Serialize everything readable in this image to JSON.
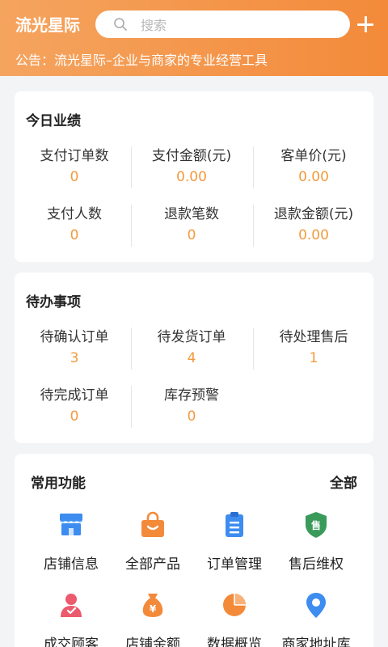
{
  "header": {
    "title": "流光星际",
    "search_placeholder": "搜索",
    "notice": "公告：流光星际–企业与商家的专业经营工具"
  },
  "today": {
    "title": "今日业绩",
    "items": [
      {
        "label": "支付订单数",
        "value": "0"
      },
      {
        "label": "支付金额(元)",
        "value": "0.00"
      },
      {
        "label": "客单价(元)",
        "value": "0.00"
      },
      {
        "label": "支付人数",
        "value": "0"
      },
      {
        "label": "退款笔数",
        "value": "0"
      },
      {
        "label": "退款金额(元)",
        "value": "0.00"
      }
    ]
  },
  "todo": {
    "title": "待办事项",
    "items": [
      {
        "label": "待确认订单",
        "value": "3"
      },
      {
        "label": "待发货订单",
        "value": "4"
      },
      {
        "label": "待处理售后",
        "value": "1"
      },
      {
        "label": "待完成订单",
        "value": "0"
      },
      {
        "label": "库存预警",
        "value": "0"
      }
    ]
  },
  "functions": {
    "title": "常用功能",
    "all_label": "全部",
    "items": [
      {
        "label": "店铺信息",
        "icon": "store-icon",
        "color": "#3d8cf0"
      },
      {
        "label": "全部产品",
        "icon": "bag-icon",
        "color": "#f38a3a"
      },
      {
        "label": "订单管理",
        "icon": "clipboard-icon",
        "color": "#3d8cf0"
      },
      {
        "label": "售后维权",
        "icon": "shield-icon",
        "color": "#3a9a5a",
        "badge": "售"
      },
      {
        "label": "成交顾客",
        "icon": "customer-icon",
        "color": "#ec5a6e"
      },
      {
        "label": "店铺余额",
        "icon": "money-bag-icon",
        "color": "#f38a3a",
        "badge": "¥"
      },
      {
        "label": "数据概览",
        "icon": "pie-chart-icon",
        "color": "#f38a3a"
      },
      {
        "label": "商家地址库",
        "icon": "location-icon",
        "color": "#3d8cf0"
      }
    ]
  }
}
